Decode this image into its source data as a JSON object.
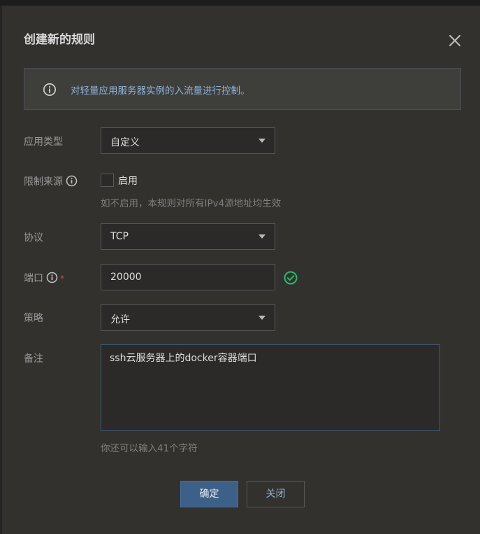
{
  "dialog": {
    "title": "创建新的规则",
    "notice": "对轻量应用服务器实例的入流量进行控制。"
  },
  "form": {
    "app_type": {
      "label": "应用类型",
      "value": "自定义"
    },
    "source_limit": {
      "label": "限制来源",
      "checkbox_label": "启用",
      "checked": false,
      "hint": "如不启用，本规则对所有IPv4源地址均生效"
    },
    "protocol": {
      "label": "协议",
      "value": "TCP"
    },
    "port": {
      "label": "端口",
      "required_mark": "*",
      "value": "20000"
    },
    "policy": {
      "label": "策略",
      "value": "允许"
    },
    "remark": {
      "label": "备注",
      "value": "ssh云服务器上的docker容器端口",
      "hint": "你还可以输入41个字符"
    }
  },
  "buttons": {
    "confirm": "确定",
    "close": "关闭"
  },
  "icons": {
    "close": "close-icon",
    "notice": "info-circle-icon",
    "help": "info-circle-icon",
    "valid": "check-circle-icon"
  },
  "colors": {
    "dialog_bg": "#33312e",
    "primary": "#3d6088",
    "link": "#8fb3d8",
    "success": "#1fbf6a",
    "required": "#c0504d"
  }
}
